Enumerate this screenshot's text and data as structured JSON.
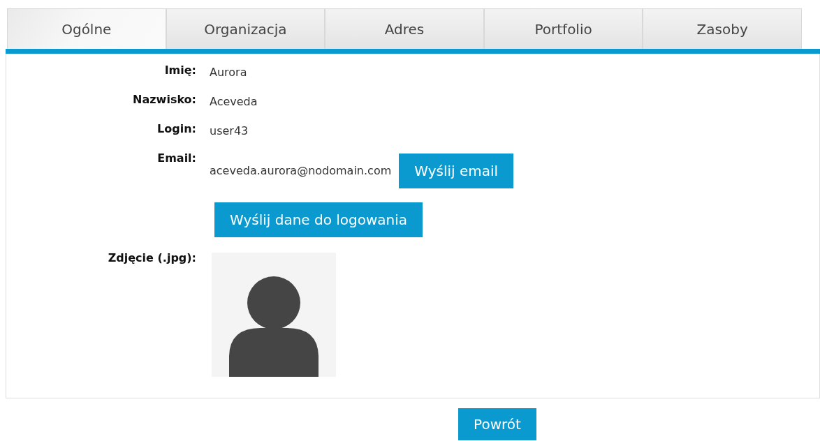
{
  "tabs": [
    {
      "label": "Ogólne",
      "selected": true
    },
    {
      "label": "Organizacja",
      "selected": false
    },
    {
      "label": "Adres",
      "selected": false
    },
    {
      "label": "Portfolio",
      "selected": false
    },
    {
      "label": "Zasoby",
      "selected": false
    }
  ],
  "fields": [
    {
      "label": "Imię:",
      "value": "Aurora"
    },
    {
      "label": "Nazwisko:",
      "value": "Aceveda"
    },
    {
      "label": "Login:",
      "value": "user43"
    },
    {
      "label": "Email:",
      "value": "aceveda.aurora@nodomain.com",
      "button": "Wyślij email"
    }
  ],
  "send_login_button": "Wyślij dane do logowania",
  "photo": {
    "label": "Zdjęcie (.jpg):"
  },
  "back_button": "Powrót"
}
